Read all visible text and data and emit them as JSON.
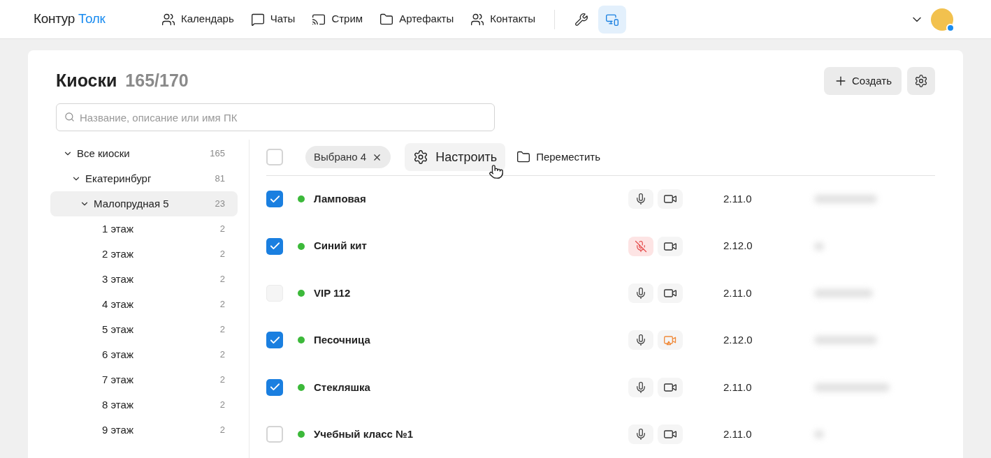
{
  "header": {
    "logo": {
      "brand": "Контур",
      "product": "Толк"
    },
    "nav": [
      {
        "label": "Календарь"
      },
      {
        "label": "Чаты"
      },
      {
        "label": "Стрим"
      },
      {
        "label": "Артефакты"
      },
      {
        "label": "Контакты"
      }
    ],
    "tools": [
      {
        "selected": false
      },
      {
        "selected": true
      }
    ],
    "avatar": {
      "online": true
    }
  },
  "page": {
    "title": "Киоски",
    "count": "165/170",
    "create_button": "Создать"
  },
  "search": {
    "placeholder": "Название, описание или имя ПК"
  },
  "tree": [
    {
      "label": "Все киоски",
      "count": "165",
      "expanded": true,
      "selected": false,
      "children": [
        {
          "label": "Екатеринбург",
          "count": "81",
          "expanded": true,
          "selected": false,
          "children": [
            {
              "label": "Малопрудная 5",
              "count": "23",
              "expanded": true,
              "selected": true,
              "children": [
                {
                  "label": "1 этаж",
                  "count": "2",
                  "selected": false
                },
                {
                  "label": "2 этаж",
                  "count": "2",
                  "selected": false
                },
                {
                  "label": "3 этаж",
                  "count": "2",
                  "selected": false
                },
                {
                  "label": "4 этаж",
                  "count": "2",
                  "selected": false
                },
                {
                  "label": "5 этаж",
                  "count": "2",
                  "selected": false
                },
                {
                  "label": "6 этаж",
                  "count": "2",
                  "selected": false
                },
                {
                  "label": "7 этаж",
                  "count": "2",
                  "selected": false
                },
                {
                  "label": "8 этаж",
                  "count": "2",
                  "selected": false
                },
                {
                  "label": "9 этаж",
                  "count": "2",
                  "selected": false
                }
              ]
            }
          ]
        }
      ]
    }
  ],
  "toolbar": {
    "select_all": {
      "checked": false
    },
    "selection_chip": "Выбрано 4",
    "actions": [
      {
        "label": "Настроить",
        "hovered": true
      },
      {
        "label": "Переместить",
        "hovered": false
      }
    ]
  },
  "kiosks": [
    {
      "name": "Ламповая",
      "checked": true,
      "disabled": false,
      "online": true,
      "mic_muted": false,
      "camera_warning": false,
      "version": "2.11.0"
    },
    {
      "name": "Синий кит",
      "checked": true,
      "disabled": false,
      "online": true,
      "mic_muted": true,
      "camera_warning": false,
      "version": "2.12.0"
    },
    {
      "name": "VIP 112",
      "checked": false,
      "disabled": true,
      "online": true,
      "mic_muted": false,
      "camera_warning": false,
      "version": "2.11.0"
    },
    {
      "name": "Песочница",
      "checked": true,
      "disabled": false,
      "online": true,
      "mic_muted": false,
      "camera_warning": true,
      "version": "2.12.0"
    },
    {
      "name": "Стекляшка",
      "checked": true,
      "disabled": false,
      "online": true,
      "mic_muted": false,
      "camera_warning": false,
      "version": "2.11.0"
    },
    {
      "name": "Учебный класс №1",
      "checked": false,
      "disabled": false,
      "online": true,
      "mic_muted": false,
      "camera_warning": false,
      "version": "2.11.0"
    }
  ]
}
